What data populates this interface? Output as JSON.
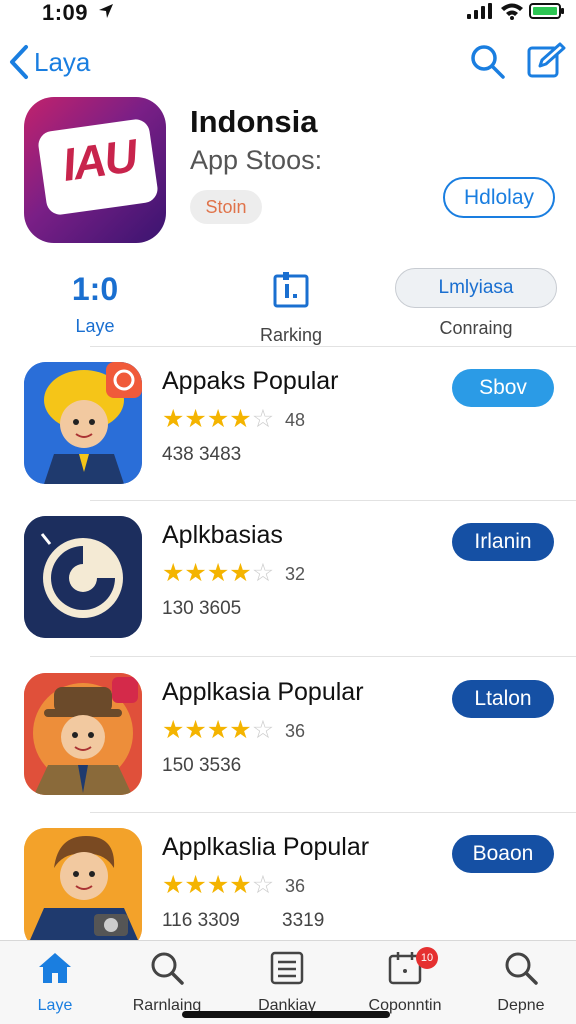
{
  "status_bar": {
    "time": "1:09"
  },
  "nav": {
    "back_label": "Laya"
  },
  "header": {
    "icon_text": "IAU",
    "title": "Indonsia",
    "subtitle": "App Stoos:",
    "badge": "Stoin",
    "button_label": "Hdlolay"
  },
  "stats": {
    "rating_value": "1:0",
    "rating_label": "Laye",
    "ranking_label": "Rarking",
    "category_pill": "Lmlyiasa",
    "category_label": "Conraing"
  },
  "apps": [
    {
      "title": "Appaks Popular",
      "stars": 4.5,
      "rating": "48",
      "count": "438 3483",
      "count2": "",
      "button": "Sbov"
    },
    {
      "title": "Aplkbasias",
      "stars": 4.5,
      "rating": "32",
      "count": "130 3605",
      "count2": "",
      "button": "Irlanin"
    },
    {
      "title": "Applkasia Popular",
      "stars": 4.5,
      "rating": "36",
      "count": "150 3536",
      "count2": "",
      "button": "Ltalon"
    },
    {
      "title": "Applkaslia Popular",
      "stars": 4.5,
      "rating": "36",
      "count": "116 3309",
      "count2": "3319",
      "button": "Boaon"
    }
  ],
  "tabs": [
    {
      "label": "Laye",
      "icon": "home-icon"
    },
    {
      "label": "Rarnlaing",
      "icon": "search-icon"
    },
    {
      "label": "Dankiay",
      "icon": "list-icon"
    },
    {
      "label": "Coponntin",
      "icon": "calendar-icon",
      "badge": "10"
    },
    {
      "label": "Depne",
      "icon": "search-icon"
    }
  ],
  "colors": {
    "accent": "#1a7ee0",
    "button_light": "#2b9be6",
    "button_dark": "#1550a4",
    "star": "#f4b400",
    "badge": "#e53030"
  }
}
